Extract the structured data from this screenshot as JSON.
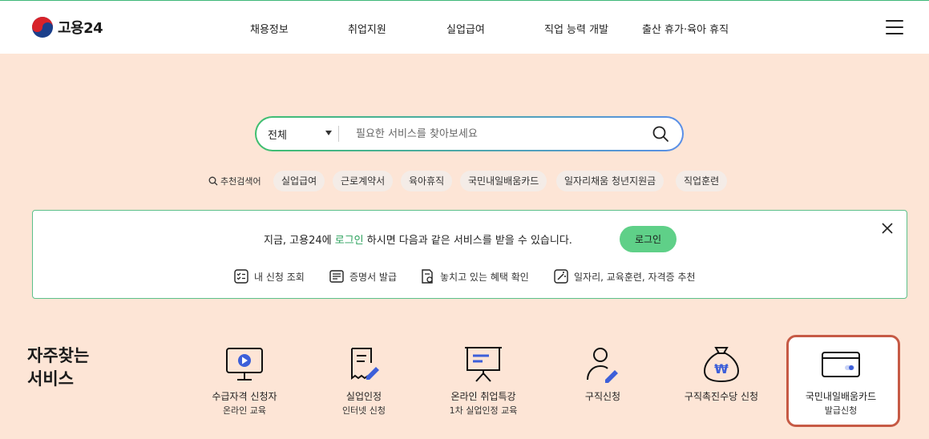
{
  "header": {
    "logo_text": "고용24",
    "nav": [
      "채용정보",
      "취업지원",
      "실업급여",
      "직업 능력 개발",
      "출산 휴가·육아 휴직"
    ]
  },
  "search": {
    "select_value": "전체",
    "placeholder": "필요한 서비스를 찾아보세요"
  },
  "recommended": {
    "label": "추천검색어",
    "chips": [
      "실업급여",
      "근로계약서",
      "육아휴직",
      "국민내일배움카드",
      "일자리채움 청년지원금",
      "직업훈련"
    ]
  },
  "login_box": {
    "msg_prefix": "지금, 고용24에 ",
    "msg_highlight": "로그인",
    "msg_suffix": " 하시면 다음과 같은 서비스를 받을 수 있습니다.",
    "button": "로그인",
    "quick_links": [
      "내 신청 조회",
      "증명서 발급",
      "놓치고 있는 혜택 확인",
      "일자리, 교육훈련, 자격증 추천"
    ]
  },
  "frequent": {
    "title_line1": "자주찾는",
    "title_line2": "서비스",
    "services": [
      {
        "line1": "수급자격 신청자",
        "line2": "온라인 교육"
      },
      {
        "line1": "실업인정",
        "line2": "인터넷 신청"
      },
      {
        "line1": "온라인 취업특강",
        "line2": "1차 실업인정 교육"
      },
      {
        "line1": "구직신청",
        "line2": ""
      },
      {
        "line1": "구직촉진수당 신청",
        "line2": ""
      },
      {
        "line1": "국민내일배움카드",
        "line2": "발급신청"
      }
    ]
  },
  "colors": {
    "background": "#fde5d6",
    "accent_green": "#5fd088",
    "highlight_border": "#c65a45",
    "icon_blue": "#3d5fd9"
  }
}
